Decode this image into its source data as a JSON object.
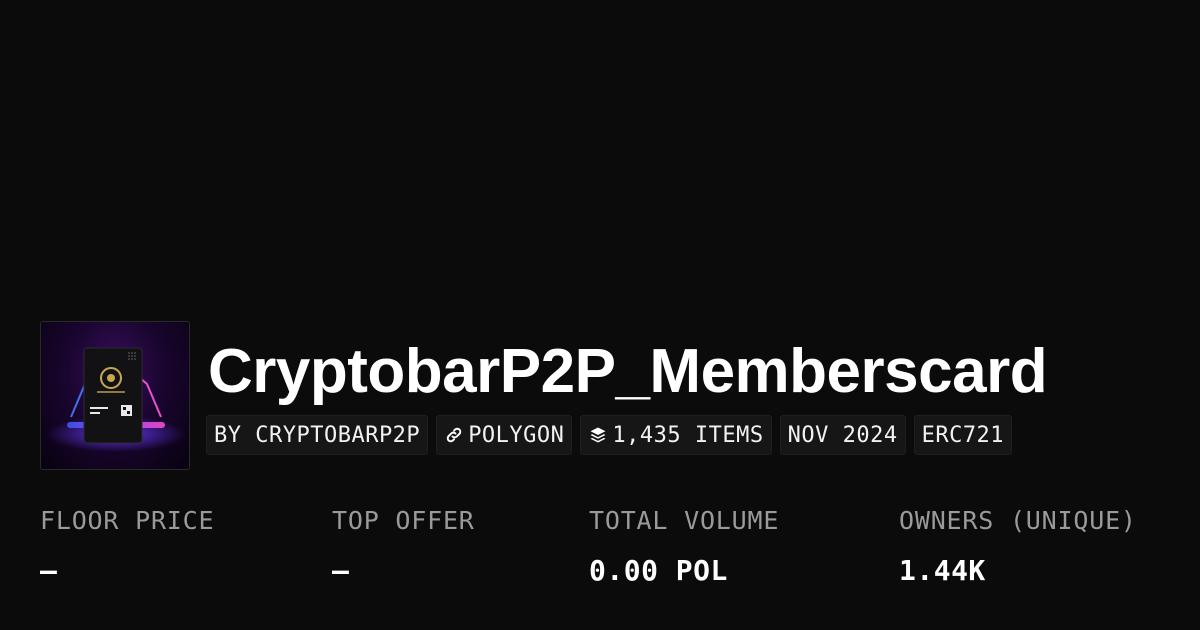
{
  "collection": {
    "name": "CryptobarP2P_Memberscard",
    "thumbnail_icon": "members-card-image",
    "tags": [
      {
        "label": "BY CRYPTOBARP2P",
        "icon": ""
      },
      {
        "label": "POLYGON",
        "icon": "link-icon"
      },
      {
        "label": "1,435 ITEMS",
        "icon": "layers-icon"
      },
      {
        "label": "NOV 2024",
        "icon": ""
      },
      {
        "label": "ERC721",
        "icon": ""
      }
    ]
  },
  "stats": [
    {
      "label": "FLOOR PRICE",
      "value": "–"
    },
    {
      "label": "TOP OFFER",
      "value": "–"
    },
    {
      "label": "TOTAL VOLUME",
      "value": "0.00 POL"
    },
    {
      "label": "OWNERS (UNIQUE)",
      "value": "1.44K"
    }
  ],
  "colors": {
    "background": "#0b0b0b",
    "tag_background": "#161616",
    "label_gray": "#9a9a9a",
    "text": "#ffffff"
  }
}
